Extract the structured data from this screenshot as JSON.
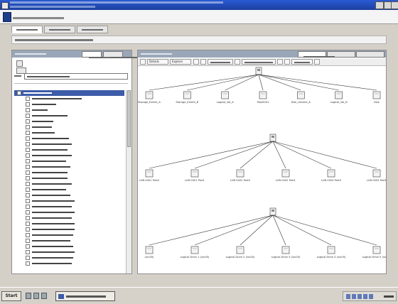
{
  "window": {
    "title": ""
  },
  "app": {
    "title": ""
  },
  "main_tabs": [
    {
      "label": "",
      "active": true
    },
    {
      "label": "",
      "active": false
    },
    {
      "label": "",
      "active": false
    }
  ],
  "breadcrumb": "",
  "left_panel": {
    "title": "",
    "tabs": [
      {
        "label": "",
        "active": true
      },
      {
        "label": "",
        "active": false
      }
    ],
    "filter_label": "",
    "filter_value": "",
    "tree_items": [
      {
        "label": "",
        "level": 0,
        "selected": true
      },
      {
        "label": "",
        "level": 1
      },
      {
        "label": "",
        "level": 1
      },
      {
        "label": "",
        "level": 1
      },
      {
        "label": "",
        "level": 1
      },
      {
        "label": "",
        "level": 1
      },
      {
        "label": "",
        "level": 1
      },
      {
        "label": "",
        "level": 1
      },
      {
        "label": "",
        "level": 1
      },
      {
        "label": "",
        "level": 1
      },
      {
        "label": "",
        "level": 1
      },
      {
        "label": "",
        "level": 1
      },
      {
        "label": "",
        "level": 1
      },
      {
        "label": "",
        "level": 1
      },
      {
        "label": "",
        "level": 1
      },
      {
        "label": "",
        "level": 1
      },
      {
        "label": "",
        "level": 1
      },
      {
        "label": "",
        "level": 1
      },
      {
        "label": "",
        "level": 1
      },
      {
        "label": "",
        "level": 1
      },
      {
        "label": "",
        "level": 1
      },
      {
        "label": "",
        "level": 1
      },
      {
        "label": "",
        "level": 1
      },
      {
        "label": "",
        "level": 1
      },
      {
        "label": "",
        "level": 1
      },
      {
        "label": "",
        "level": 1
      },
      {
        "label": "",
        "level": 1
      },
      {
        "label": "",
        "level": 1
      },
      {
        "label": "",
        "level": 1
      },
      {
        "label": "",
        "level": 1
      },
      {
        "label": "",
        "level": 1
      }
    ]
  },
  "right_panel": {
    "title": "",
    "tabs": [
      {
        "label": "",
        "active": true
      },
      {
        "label": "",
        "active": false
      },
      {
        "label": "",
        "active": false
      }
    ],
    "toolbar": {
      "details": "Details",
      "explore": "Explore"
    },
    "diagram": {
      "groups": [
        {
          "root": "",
          "edge_label": "",
          "children": [
            "Storage_Extent_A",
            "Storage_Extent_B",
            "Logical_Vol_A",
            "Pool0001",
            "Disk_Volume_A",
            "Logical_Vol_B",
            "Disk"
          ]
        },
        {
          "root": "",
          "edge_label": "",
          "children": [
            "LUN 0001 Part0",
            "LUN 0001 Part1",
            "LUN 0002 Part0",
            "LUN 0002 Part1",
            "LUN 0003 Part0",
            "LUN 0003 Part1"
          ]
        },
        {
          "root": "",
          "edge_label": "",
          "children": [
            "(lun00)",
            "Logical Drive 1 (lun00)",
            "Logical Drive 2 (lun00)",
            "Logical Drive 3 (lun00)",
            "Logical Drive 4 (lun00)",
            "Logical Drive 5 (lun00)"
          ]
        }
      ]
    }
  },
  "taskbar": {
    "start": "Start",
    "task_button": "",
    "clock": ""
  },
  "colors": {
    "title_bar": "#1c3f9e",
    "tree_selection": "#3c5ba8",
    "panel_header": "#9aa7b8"
  }
}
